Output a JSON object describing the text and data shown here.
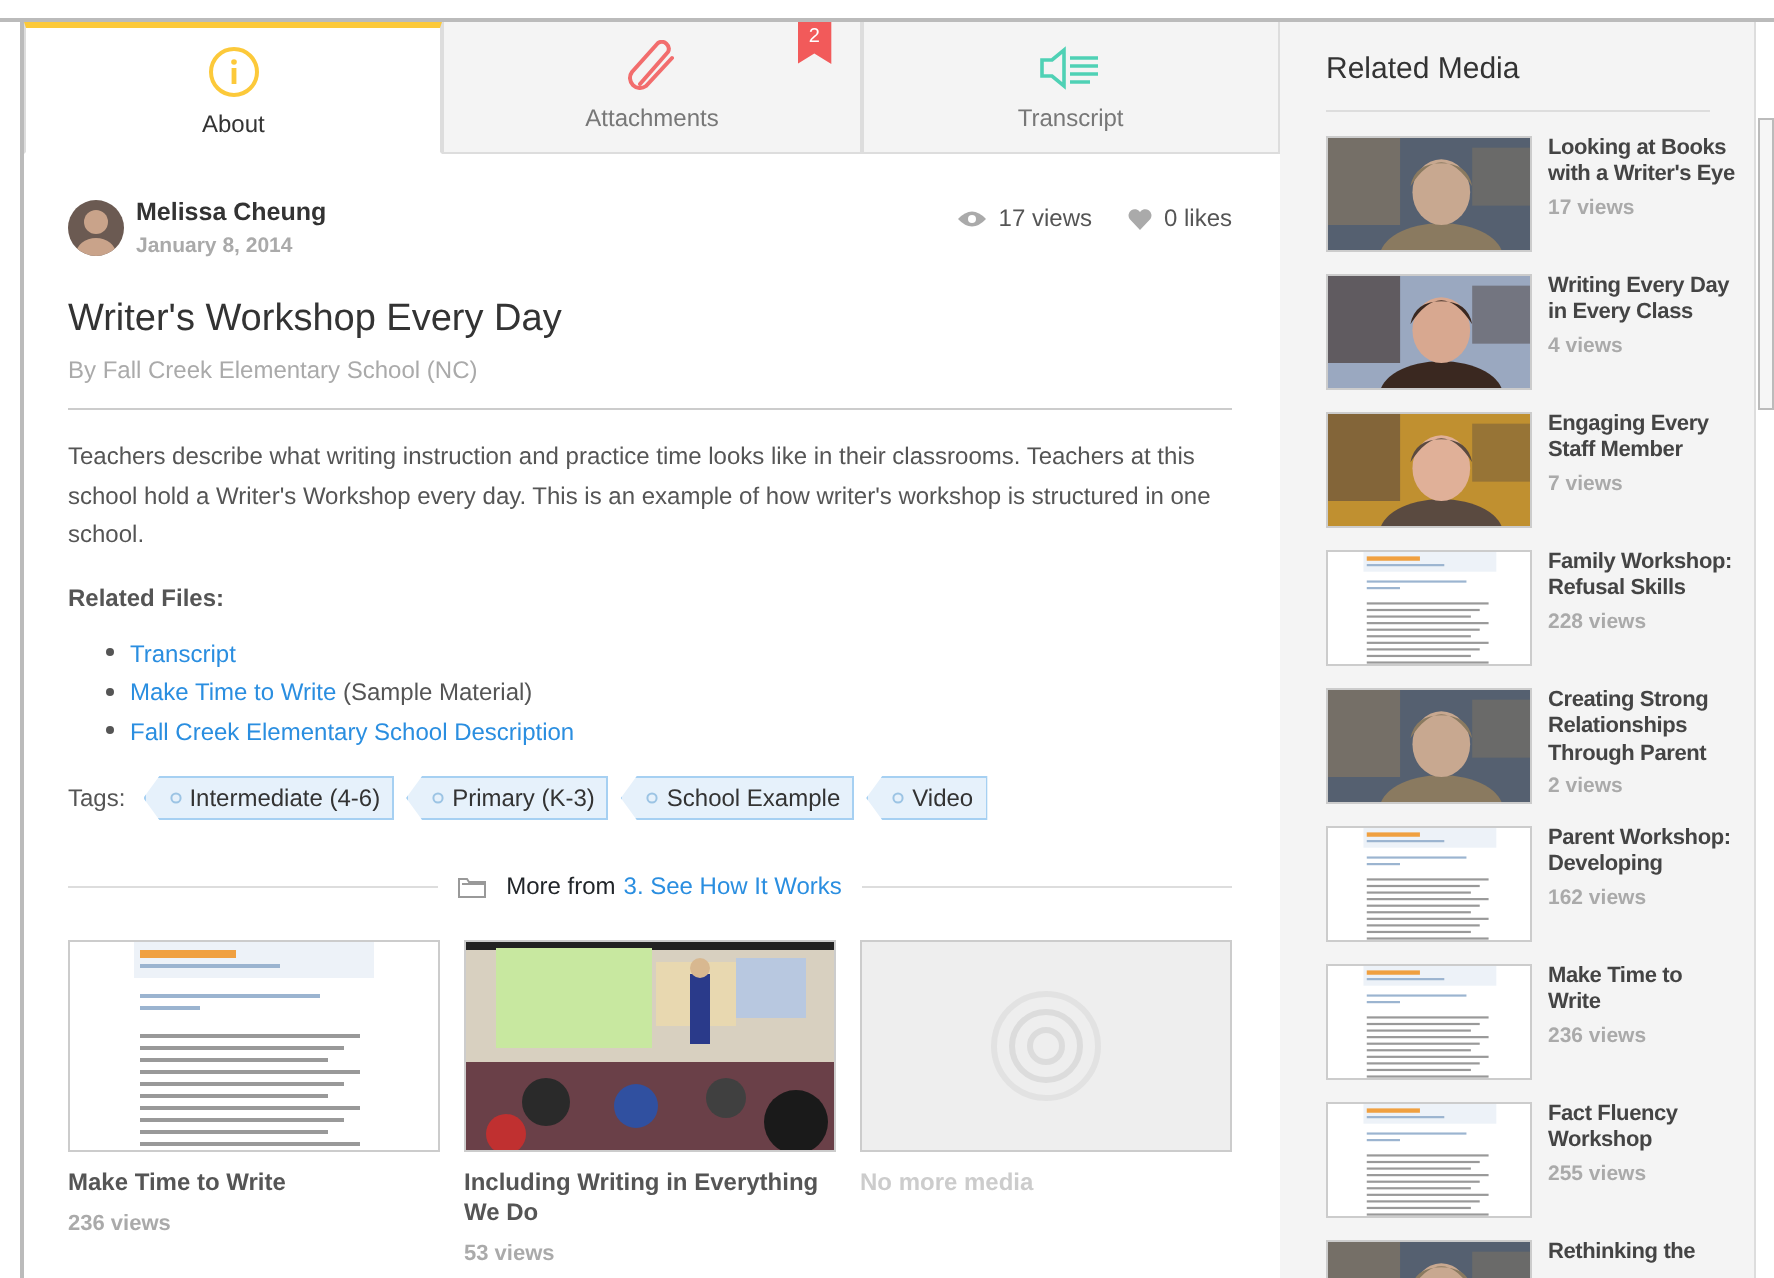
{
  "tabs": [
    {
      "label": "About",
      "selected": true
    },
    {
      "label": "Attachments",
      "selected": false,
      "badge": "2"
    },
    {
      "label": "Transcript",
      "selected": false
    }
  ],
  "author": {
    "name": "Melissa Cheung",
    "date": "January 8, 2014"
  },
  "stats": {
    "views": "17 views",
    "likes": "0 likes"
  },
  "title": "Writer's Workshop Every Day",
  "byline": "By Fall Creek Elementary School (NC)",
  "description": "Teachers describe what writing instruction and practice time looks like in their classrooms. Teachers at this school hold a Writer's Workshop every day. This is an example of how writer's workshop is structured in one school.",
  "related_files": {
    "heading": "Related Files:",
    "items": [
      {
        "link": "Transcript"
      },
      {
        "link": "Make Time to Write",
        "note": "(Sample Material)"
      },
      {
        "link": "Fall Creek Elementary School Description"
      }
    ]
  },
  "tags": {
    "label": "Tags:",
    "items": [
      "Intermediate (4-6)",
      "Primary (K-3)",
      "School Example",
      "Video"
    ]
  },
  "more_from": {
    "prefix": "More from",
    "link": "3. See How It Works"
  },
  "media": [
    {
      "kind": "document",
      "title": "Make Time to Write",
      "views": "236 views"
    },
    {
      "kind": "picture",
      "title": "Including Writing in Everything We Do",
      "views": "53 views"
    },
    {
      "kind": "empty",
      "title": "No more media"
    }
  ],
  "sidebar": {
    "title": "Related Media",
    "items": [
      {
        "kind": "picture",
        "title": "Looking at Books with a Writer's Eye",
        "views": "17 views"
      },
      {
        "kind": "picture",
        "title": "Writing Every Day in Every Class",
        "views": "4 views"
      },
      {
        "kind": "picture",
        "title": "Engaging Every Staff Member",
        "views": "7 views"
      },
      {
        "kind": "document",
        "title": "Family Workshop: Refusal Skills",
        "views": "228 views"
      },
      {
        "kind": "picture",
        "title": "Creating Strong Relationships Through Parent",
        "views": "2 views"
      },
      {
        "kind": "document",
        "title": "Parent Workshop: Developing",
        "views": "162 views"
      },
      {
        "kind": "document",
        "title": "Make Time to Write",
        "views": "236 views"
      },
      {
        "kind": "document",
        "title": "Fact Fluency Workshop",
        "views": "255 views"
      },
      {
        "kind": "picture",
        "title": "Rethinking the"
      }
    ]
  }
}
